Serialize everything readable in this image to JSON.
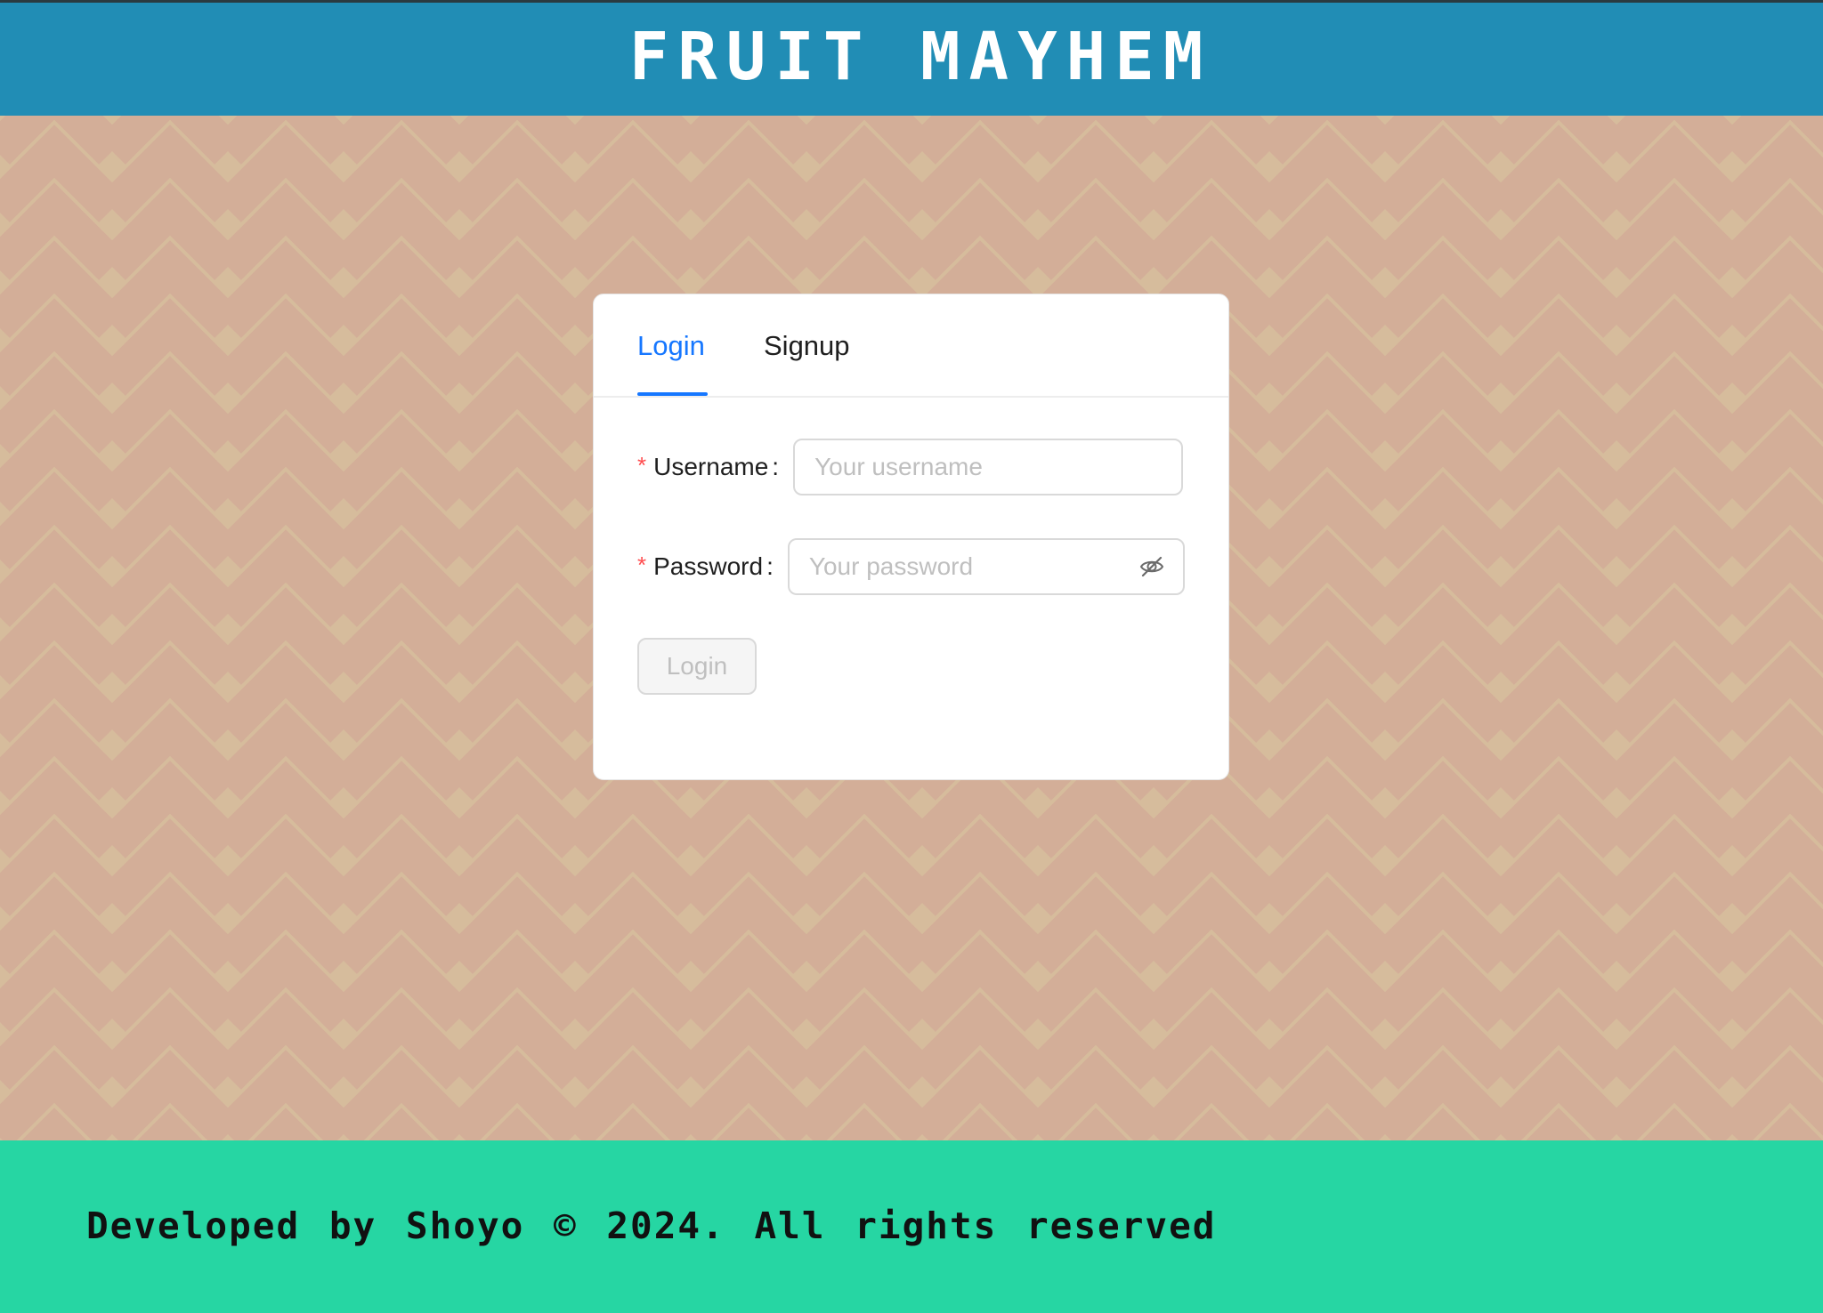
{
  "header": {
    "title": "FRUIT MAYHEM"
  },
  "auth_card": {
    "tabs": [
      {
        "label": "Login",
        "active": true
      },
      {
        "label": "Signup",
        "active": false
      }
    ],
    "username": {
      "required_mark": "*",
      "label": "Username",
      "colon": ":",
      "value": "",
      "placeholder": "Your username"
    },
    "password": {
      "required_mark": "*",
      "label": "Password",
      "colon": ":",
      "value": "",
      "placeholder": "Your password",
      "toggle_icon": "eye-invisible-icon"
    },
    "submit_label": "Login",
    "submit_disabled": true
  },
  "footer": {
    "text": "Developed by Shoyo © 2024. All rights reserved"
  },
  "colors": {
    "header_bg": "#218db5",
    "footer_bg": "#26d6a3",
    "page_bg": "#d6bc9c",
    "chevron": "#d3ae98",
    "accent": "#1677ff",
    "required": "#ff4d4f"
  }
}
